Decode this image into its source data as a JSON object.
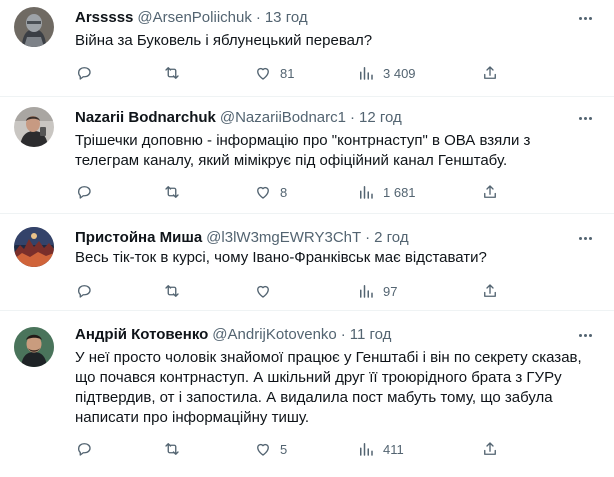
{
  "tweets": [
    {
      "name": "Arsssss",
      "handle": "@ArsenPoliichuk",
      "separator": "·",
      "time": "13 год",
      "text": "Війна за Буковель і яблунецький перевал?",
      "reply_count": "",
      "retweet_count": "",
      "like_count": "81",
      "view_count": "3 409"
    },
    {
      "name": "Nazarii Bodnarchuk",
      "handle": "@NazariiBodnarc1",
      "separator": "·",
      "time": "12 год",
      "text": "Трішечки доповню - інформацію про \"контрнаступ\" в ОВА взяли з телеграм каналу, який мімікрує під офіційний канал Генштабу.",
      "reply_count": "",
      "retweet_count": "",
      "like_count": "8",
      "view_count": "1 681"
    },
    {
      "name": "Пристойна Миша",
      "handle": "@l3lW3mgEWRY3ChT",
      "separator": "·",
      "time": "2 год",
      "text": "Весь тік-ток в курсі, чому Івано-Франківськ має відставати?",
      "reply_count": "",
      "retweet_count": "",
      "like_count": "",
      "view_count": "97"
    },
    {
      "name": "Андрій Котовенко",
      "handle": "@AndrijKotovenko",
      "separator": "·",
      "time": "11 год",
      "text": "У неї просто чоловік знайомої працює у Генштабі і він по секрету сказав, що почався контрнаступ. А шкільний друг її троюрідного брата з ГУРу підтвердив, от і запостила. А видалила пост мабуть тому, що забула написати про інформаційну тишу.",
      "reply_count": "",
      "retweet_count": "",
      "like_count": "5",
      "view_count": "411"
    }
  ],
  "icons": {
    "reply": "reply-icon",
    "retweet": "retweet-icon",
    "like": "heart-icon",
    "views": "views-icon",
    "share": "share-icon",
    "more": "more-icon"
  },
  "colors": {
    "text": "#0f1419",
    "secondary": "#536471",
    "divider": "#eff3f4"
  }
}
